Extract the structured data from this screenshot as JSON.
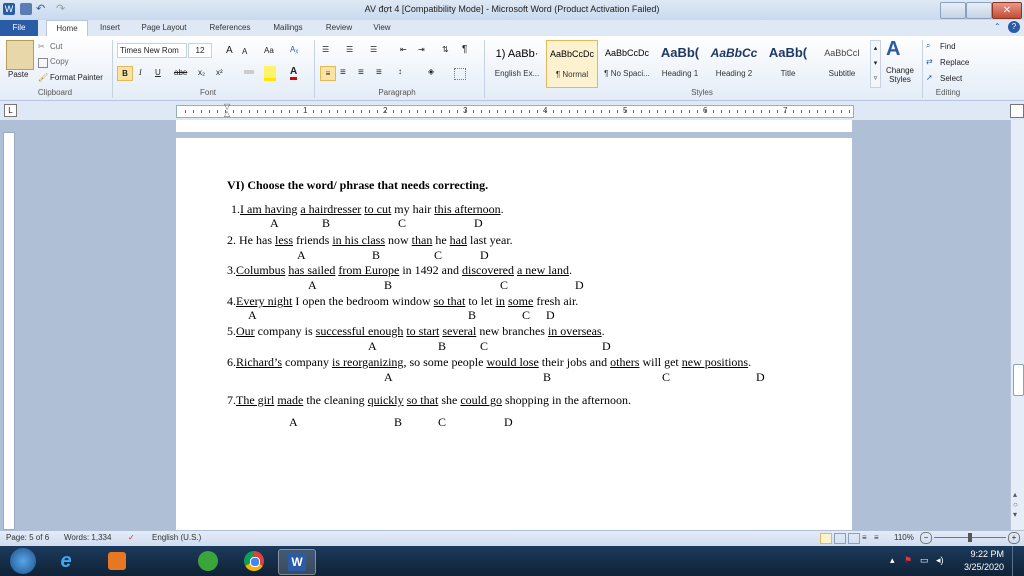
{
  "window": {
    "title": "AV đợt 4 [Compatibility Mode]  -  Microsoft Word (Product Activation Failed)",
    "close_glyph": "✕"
  },
  "quick_access": [
    "word-icon",
    "save-icon",
    "undo-icon",
    "redo-icon"
  ],
  "tabs": [
    "File",
    "Home",
    "Insert",
    "Page Layout",
    "References",
    "Mailings",
    "Review",
    "View"
  ],
  "ribbon": {
    "clipboard": {
      "paste": "Paste",
      "cut": "Cut",
      "copy": "Copy",
      "format_painter": "Format Painter",
      "label": "Clipboard"
    },
    "font": {
      "name": "Times New Rom",
      "size": "12",
      "grow": "A",
      "shrink": "A",
      "case": "Aa",
      "bold": "B",
      "italic": "I",
      "underline": "U",
      "strike": "abe",
      "sub": "x₂",
      "sup": "x²",
      "label": "Font"
    },
    "paragraph": {
      "label": "Paragraph",
      "pilcrow": "¶"
    },
    "styles": {
      "label": "Styles",
      "items": [
        {
          "sample": "1) AaBb·",
          "name": "English Ex..."
        },
        {
          "sample": "AaBbCcDc",
          "name": "¶ Normal"
        },
        {
          "sample": "AaBbCcDc",
          "name": "¶ No Spaci..."
        },
        {
          "sample": "AaBb(",
          "name": "Heading 1"
        },
        {
          "sample": "AaBbCc",
          "name": "Heading 2"
        },
        {
          "sample": "AaBb(",
          "name": "Title"
        },
        {
          "sample": "AaBbCcI",
          "name": "Subtitle"
        }
      ],
      "change_styles": "Change Styles"
    },
    "editing": {
      "find": "Find",
      "replace": "Replace",
      "select": "Select",
      "label": "Editing"
    }
  },
  "ruler": {
    "numbers": [
      "1",
      "2",
      "3",
      "4",
      "5",
      "6",
      "7"
    ]
  },
  "document": {
    "heading": "VI) Choose the word/ phrase that needs correcting.",
    "q1": {
      "num": "1.",
      "a": "I am having",
      "b": "a hairdresser",
      "c": "to cut",
      "t1": "my hair",
      "d": "this afternoon",
      "end": "."
    },
    "q2": {
      "num": "2. He has ",
      "a": "less",
      "t1": " friends ",
      "b": "in his class",
      "t2": " now ",
      "c": "than",
      "t3": " he ",
      "d": "had",
      "t4": " last year."
    },
    "q3": {
      "num": "3.",
      "a": "Columbus",
      "t0": " ",
      "b1": "has sailed",
      "t1": " ",
      "b": "from Europe",
      "t2": " in 1492 and ",
      "c": "discovered",
      "t3": " ",
      "d": "a new land",
      "end": "."
    },
    "q4": {
      "num": "4.",
      "a": "Every night",
      "t1": " I open the bedroom window ",
      "b": "so that",
      "t2": " to let ",
      "c": "in",
      "t3": " ",
      "d": "some",
      "t4": " fresh air."
    },
    "q5": {
      "num": "5.",
      "a0": "Our",
      "t0": " company is ",
      "a": "successful enough",
      "t1": "  ",
      "b": "to start",
      "t2": " ",
      "c": "several",
      "t3": " new branches ",
      "d": "in overseas",
      "end": "."
    },
    "q6": {
      "num": "6.",
      "a0": "Richard’s",
      "t0": " company ",
      "a": "is reorganizing",
      "t1": ", so some people ",
      "b": "would lose",
      "t2": " their jobs and ",
      "c": "others",
      "t3": " will get ",
      "d": "new positions",
      "end": "."
    },
    "q7": {
      "num": "7.",
      "a0": "The girl",
      "t0": " ",
      "a": "made",
      "t1": " the cleaning ",
      "b": "quickly",
      "t2": " ",
      "c": "so that",
      "t3": " she ",
      "d": "could go",
      "t4": " shopping in the afternoon."
    },
    "letters": [
      "A",
      "B",
      "C",
      "D"
    ]
  },
  "status": {
    "page": "Page: 5 of 6",
    "words": "Words: 1,334",
    "language": "English (U.S.)",
    "zoom": "110%"
  },
  "taskbar": {
    "time": "9:22 PM",
    "date": "3/25/2020",
    "apps": [
      "windows-start-icon",
      "internet-explorer-icon",
      "media-player-icon",
      "greenshot-icon",
      "chrome-icon",
      "word-icon"
    ]
  },
  "colors": {
    "ribbon_blue": "#2a5ba6",
    "taskbar": "#1c3a5c",
    "doc_bg": "#aebfd6"
  }
}
